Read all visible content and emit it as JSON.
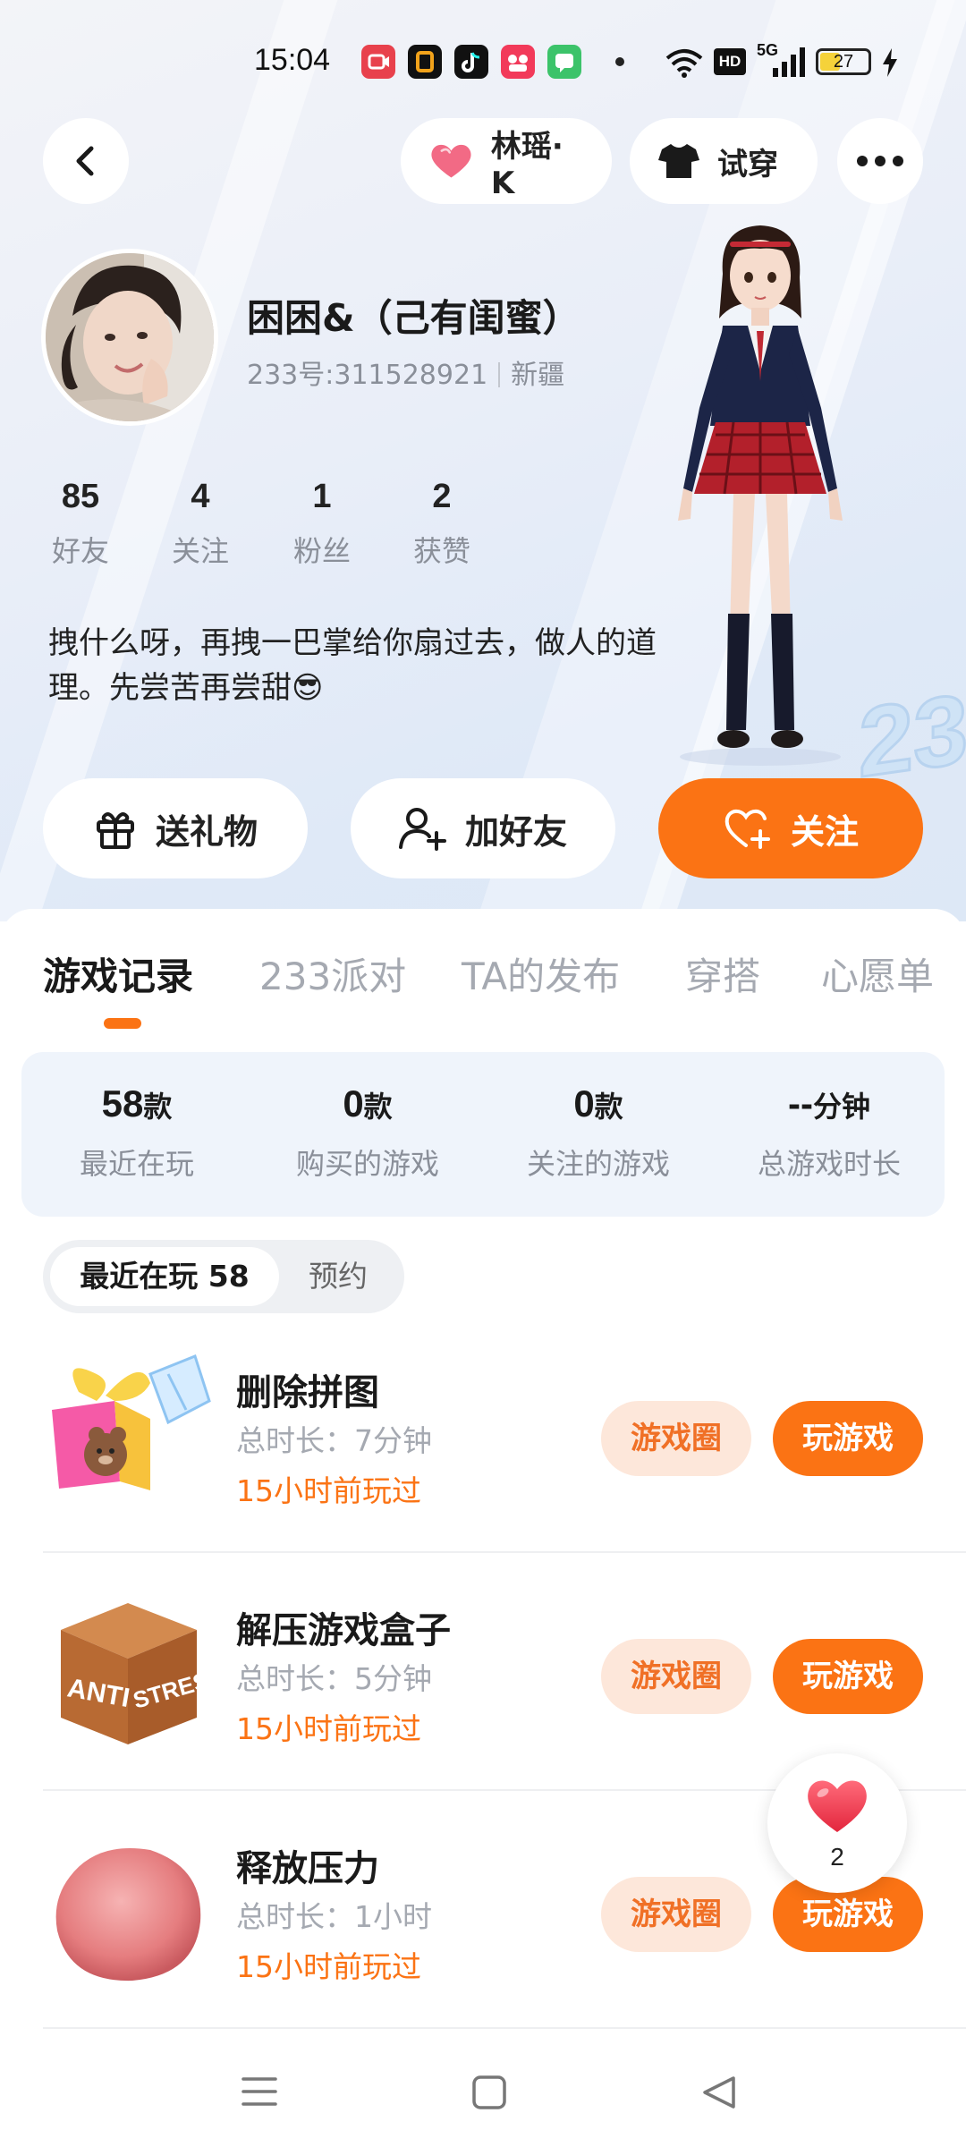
{
  "status_bar": {
    "time": "15:04",
    "signal_text": "HD",
    "network": "5G",
    "battery_level": "27",
    "app_icons": [
      "video-icon",
      "orange-square-icon",
      "tiktok-icon",
      "flower-app-icon",
      "chat-app-icon"
    ]
  },
  "top_nav": {
    "partner_name": "林瑶· K",
    "try_on_label": "试穿"
  },
  "profile": {
    "name": "困困&（己有闺蜜）",
    "uid": "233号:311528921",
    "region": "新疆",
    "stats": [
      {
        "value": "85",
        "label": "好友"
      },
      {
        "value": "4",
        "label": "关注"
      },
      {
        "value": "1",
        "label": "粉丝"
      },
      {
        "value": "2",
        "label": "获赞"
      }
    ],
    "bio": "拽什么呀，再拽一巴掌给你扇过去，做人的道理。先尝苦再尝甜😎"
  },
  "actions": {
    "gift": "送礼物",
    "add_friend": "加好友",
    "follow": "关注"
  },
  "tabs": [
    "游戏记录",
    "233派对",
    "TA的发布",
    "穿搭",
    "心愿单"
  ],
  "summary": [
    {
      "value": "58",
      "unit": "款",
      "label": "最近在玩"
    },
    {
      "value": "0",
      "unit": "款",
      "label": "购买的游戏"
    },
    {
      "value": "0",
      "unit": "款",
      "label": "关注的游戏"
    },
    {
      "value": "--",
      "unit": "分钟",
      "label": "总游戏时长"
    }
  ],
  "subtabs": {
    "recent": "最近在玩 58",
    "reserve": "预约"
  },
  "games": [
    {
      "title": "删除拼图",
      "duration": "总时长：7分钟",
      "last_played": "15小时前玩过",
      "circle_label": "游戏圈",
      "play_label": "玩游戏"
    },
    {
      "title": "解压游戏盒子",
      "duration": "总时长：5分钟",
      "last_played": "15小时前玩过",
      "circle_label": "游戏圈",
      "play_label": "玩游戏",
      "icon_text_left": "ANTI",
      "icon_text_right": "STRESS"
    },
    {
      "title": "释放压力",
      "duration": "总时长：1小时",
      "last_played": "15小时前玩过",
      "circle_label": "游戏圈",
      "play_label": "玩游戏"
    }
  ],
  "float_like": {
    "count": "2"
  },
  "colors": {
    "accent": "#fb7314",
    "accent_light": "#fde7da",
    "muted": "#8a8f99",
    "summary_bg": "#eff4fb"
  }
}
